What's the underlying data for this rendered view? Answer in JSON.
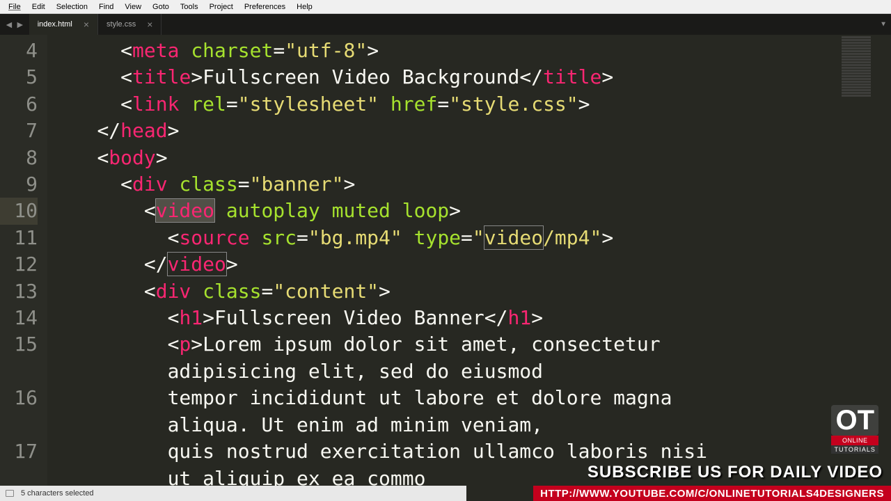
{
  "menu": [
    "File",
    "Edit",
    "Selection",
    "Find",
    "View",
    "Goto",
    "Tools",
    "Project",
    "Preferences",
    "Help"
  ],
  "tabs": [
    {
      "label": "index.html",
      "active": true
    },
    {
      "label": "style.css",
      "active": false
    }
  ],
  "line_numbers": [
    "4",
    "5",
    "6",
    "7",
    "8",
    "9",
    "10",
    "11",
    "12",
    "13",
    "14",
    "15",
    "",
    "16",
    "",
    "17",
    ""
  ],
  "current_line_index": 6,
  "code": {
    "l4": {
      "tag": "meta",
      "attr": "charset",
      "val": "\"utf-8\""
    },
    "l5": {
      "tag": "title",
      "text": "Fullscreen Video Background"
    },
    "l6": {
      "tag": "link",
      "a1": "rel",
      "v1": "\"stylesheet\"",
      "a2": "href",
      "v2": "\"style.css\""
    },
    "l7": {
      "tag": "head"
    },
    "l8": {
      "tag": "body"
    },
    "l9": {
      "tag": "div",
      "attr": "class",
      "val": "\"banner\""
    },
    "l10": {
      "tag": "video",
      "attrs": "autoplay muted loop"
    },
    "l11": {
      "tag": "source",
      "a1": "src",
      "v1": "\"bg.mp4\"",
      "a2": "type",
      "v2pre": "\"",
      "v2hl": "video",
      "v2post": "/mp4\""
    },
    "l12": {
      "tag": "video"
    },
    "l13": {
      "tag": "div",
      "attr": "class",
      "val": "\"content\""
    },
    "l14": {
      "tag": "h1",
      "text": "Fullscreen Video Banner"
    },
    "l15a": {
      "tag": "p",
      "text": "Lorem ipsum dolor sit amet, consectetur"
    },
    "l15b": "adipisicing elit, sed do eiusmod",
    "l16a": "tempor incididunt ut labore et dolore magna",
    "l16b": "aliqua. Ut enim ad minim veniam,",
    "l17a": "quis nostrud exercitation ullamco laboris nisi",
    "l17b": "ut aliquip ex ea commo"
  },
  "status": {
    "text": "5 characters selected"
  },
  "overlay": {
    "subscribe": "SUBSCRIBE US FOR DAILY VIDEO",
    "url": "HTTP://WWW.YOUTUBE.COM/C/ONLINETUTORIALS4DESIGNERS",
    "logo_big": "OT",
    "logo_s1": "ONLINE",
    "logo_s2": "TUTORIALS"
  }
}
